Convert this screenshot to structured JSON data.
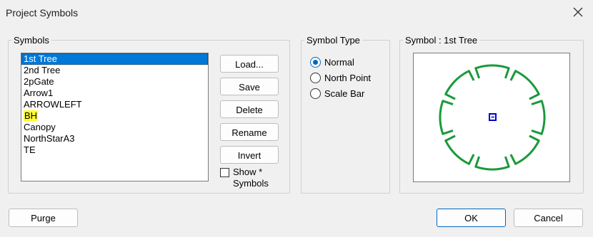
{
  "window": {
    "title": "Project Symbols",
    "close_icon": "close-icon"
  },
  "symbols_group": {
    "legend": "Symbols",
    "items": [
      {
        "label": "1st Tree",
        "selected": true
      },
      {
        "label": "2nd Tree"
      },
      {
        "label": "2pGate"
      },
      {
        "label": "Arrow1"
      },
      {
        "label": "ARROWLEFT"
      },
      {
        "label": "BH",
        "highlighted": true
      },
      {
        "label": "Canopy"
      },
      {
        "label": "NorthStarA3"
      },
      {
        "label": "TE"
      }
    ],
    "buttons": {
      "load": "Load...",
      "save": "Save",
      "delete": "Delete",
      "rename": "Rename",
      "invert": "Invert"
    },
    "show_symbols": {
      "label": "Show * Symbols",
      "checked": false
    }
  },
  "symbol_type_group": {
    "legend": "Symbol Type",
    "options": [
      {
        "label": "Normal",
        "checked": true
      },
      {
        "label": "North Point",
        "checked": false
      },
      {
        "label": "Scale Bar",
        "checked": false
      }
    ]
  },
  "preview_group": {
    "legend": "Symbol : 1st Tree",
    "colors": {
      "tree_stroke": "#1a9a3a",
      "center_marker": "#0000cc"
    }
  },
  "footer": {
    "purge": "Purge",
    "ok": "OK",
    "cancel": "Cancel"
  },
  "colors": {
    "selection": "#0078d7",
    "highlight": "#ffff33",
    "accent": "#0067c0"
  }
}
